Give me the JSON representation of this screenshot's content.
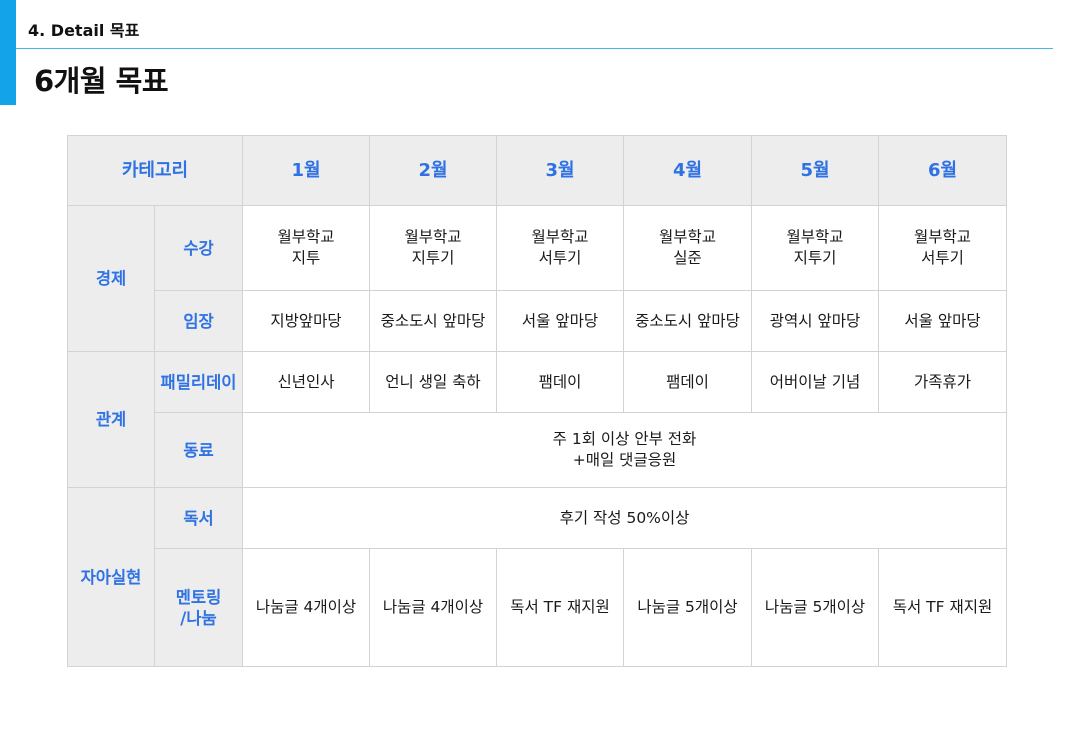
{
  "header": {
    "section_label": "4. Detail 목표",
    "title": "6개월 목표"
  },
  "colors": {
    "accent": "#12a3e8",
    "heading_blue": "#2f72e3",
    "header_fill": "#ededed"
  },
  "table": {
    "corner": "카테고리",
    "months": [
      "1월",
      "2월",
      "3월",
      "4월",
      "5월",
      "6월"
    ],
    "categories": {
      "economy": {
        "label": "경제",
        "course": {
          "label": "수강",
          "cells": [
            [
              "월부학교",
              "지투"
            ],
            [
              "월부학교",
              "지투기"
            ],
            [
              "월부학교",
              "서투기"
            ],
            [
              "월부학교",
              "실준"
            ],
            [
              "월부학교",
              "지투기"
            ],
            [
              "월부학교",
              "서투기"
            ]
          ]
        },
        "field": {
          "label": "임장",
          "cells": [
            "지방앞마당",
            "중소도시 앞마당",
            "서울 앞마당",
            "중소도시 앞마당",
            "광역시 앞마당",
            "서울 앞마당"
          ]
        }
      },
      "relations": {
        "label": "관계",
        "family": {
          "label": "패밀리데이",
          "cells": [
            "신년인사",
            "언니 생일 축하",
            "팸데이",
            "팸데이",
            "어버이날 기념",
            "가족휴가"
          ]
        },
        "colleague": {
          "label": "동료",
          "lines": [
            "주 1회 이상 안부 전화",
            "+매일 댓글응원"
          ]
        }
      },
      "self": {
        "label": "자아실현",
        "reading": {
          "label": "독서",
          "text": "후기 작성 50%이상"
        },
        "mentoring": {
          "label_lines": [
            "멘토링",
            "/나눔"
          ],
          "cells": [
            "나눔글 4개이상",
            "나눔글 4개이상",
            "독서 TF 재지원",
            "나눔글 5개이상",
            "나눔글 5개이상",
            "독서 TF 재지원"
          ]
        }
      }
    }
  }
}
